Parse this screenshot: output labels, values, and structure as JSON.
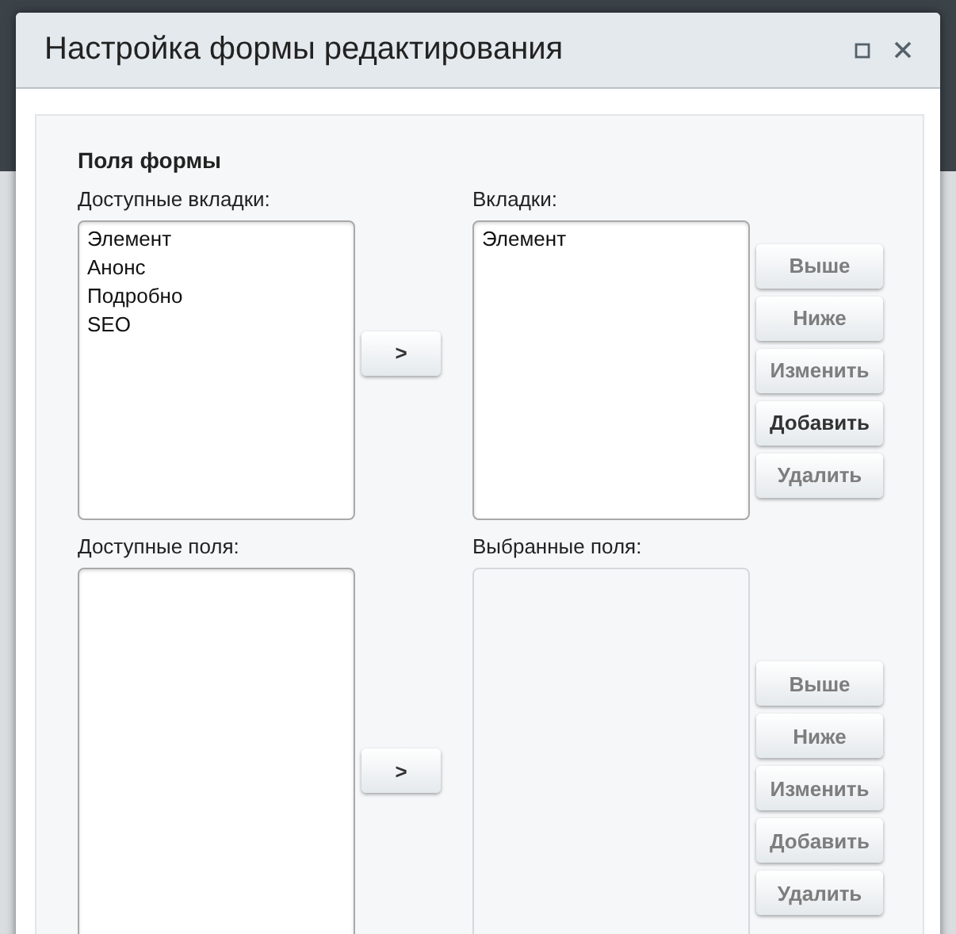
{
  "window": {
    "title": "Настройка формы редактирования"
  },
  "form": {
    "heading": "Поля формы",
    "groups": [
      {
        "available": {
          "label": "Доступные вкладки:",
          "items": [
            "Элемент",
            "Анонс",
            "Подробно",
            "SEO"
          ]
        },
        "move_button": {
          "label": ">"
        },
        "selected": {
          "label": "Вкладки:",
          "disabled": false,
          "items": [
            "Элемент"
          ]
        },
        "buttons": [
          {
            "label": "Выше",
            "disabled": true
          },
          {
            "label": "Ниже",
            "disabled": true
          },
          {
            "label": "Изменить",
            "disabled": true
          },
          {
            "label": "Добавить",
            "disabled": false
          },
          {
            "label": "Удалить",
            "disabled": true
          }
        ]
      },
      {
        "available": {
          "label": "Доступные поля:"
        },
        "move_button": {
          "label": ">"
        },
        "selected": {
          "label": "Выбранные поля:",
          "disabled": true
        },
        "buttons": [
          {
            "label": "Выше",
            "disabled": true
          },
          {
            "label": "Ниже",
            "disabled": true
          },
          {
            "label": "Изменить",
            "disabled": true
          },
          {
            "label": "Добавить",
            "disabled": true
          },
          {
            "label": "Удалить",
            "disabled": true
          }
        ]
      }
    ]
  }
}
